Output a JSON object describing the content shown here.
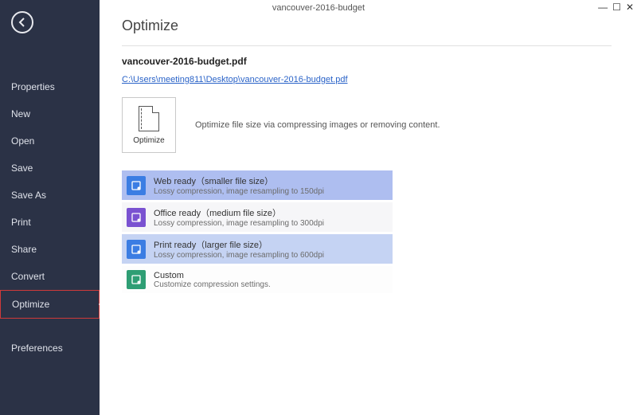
{
  "window": {
    "title": "vancouver-2016-budget"
  },
  "sidebar": {
    "items": [
      {
        "key": "properties",
        "label": "Properties"
      },
      {
        "key": "new",
        "label": "New"
      },
      {
        "key": "open",
        "label": "Open"
      },
      {
        "key": "save",
        "label": "Save"
      },
      {
        "key": "saveas",
        "label": "Save As"
      },
      {
        "key": "print",
        "label": "Print"
      },
      {
        "key": "share",
        "label": "Share"
      },
      {
        "key": "convert",
        "label": "Convert"
      },
      {
        "key": "optimize",
        "label": "Optimize"
      },
      {
        "key": "preferences",
        "label": "Preferences"
      }
    ],
    "selected": "optimize"
  },
  "page": {
    "title": "Optimize",
    "filename": "vancouver-2016-budget.pdf",
    "filepath": "C:\\Users\\meeting811\\Desktop\\vancouver-2016-budget.pdf",
    "heroTileLabel": "Optimize",
    "heroDescription": "Optimize file size via compressing images or removing content."
  },
  "options": {
    "web": {
      "title": "Web ready（smaller file size）",
      "subtitle": "Lossy compression, image resampling to 150dpi"
    },
    "office": {
      "title": "Office ready（medium file size）",
      "subtitle": "Lossy compression, image resampling to 300dpi"
    },
    "print": {
      "title": "Print ready（larger file size）",
      "subtitle": "Lossy compression, image resampling to 600dpi"
    },
    "custom": {
      "title": "Custom",
      "subtitle": "Customize compression settings."
    }
  }
}
